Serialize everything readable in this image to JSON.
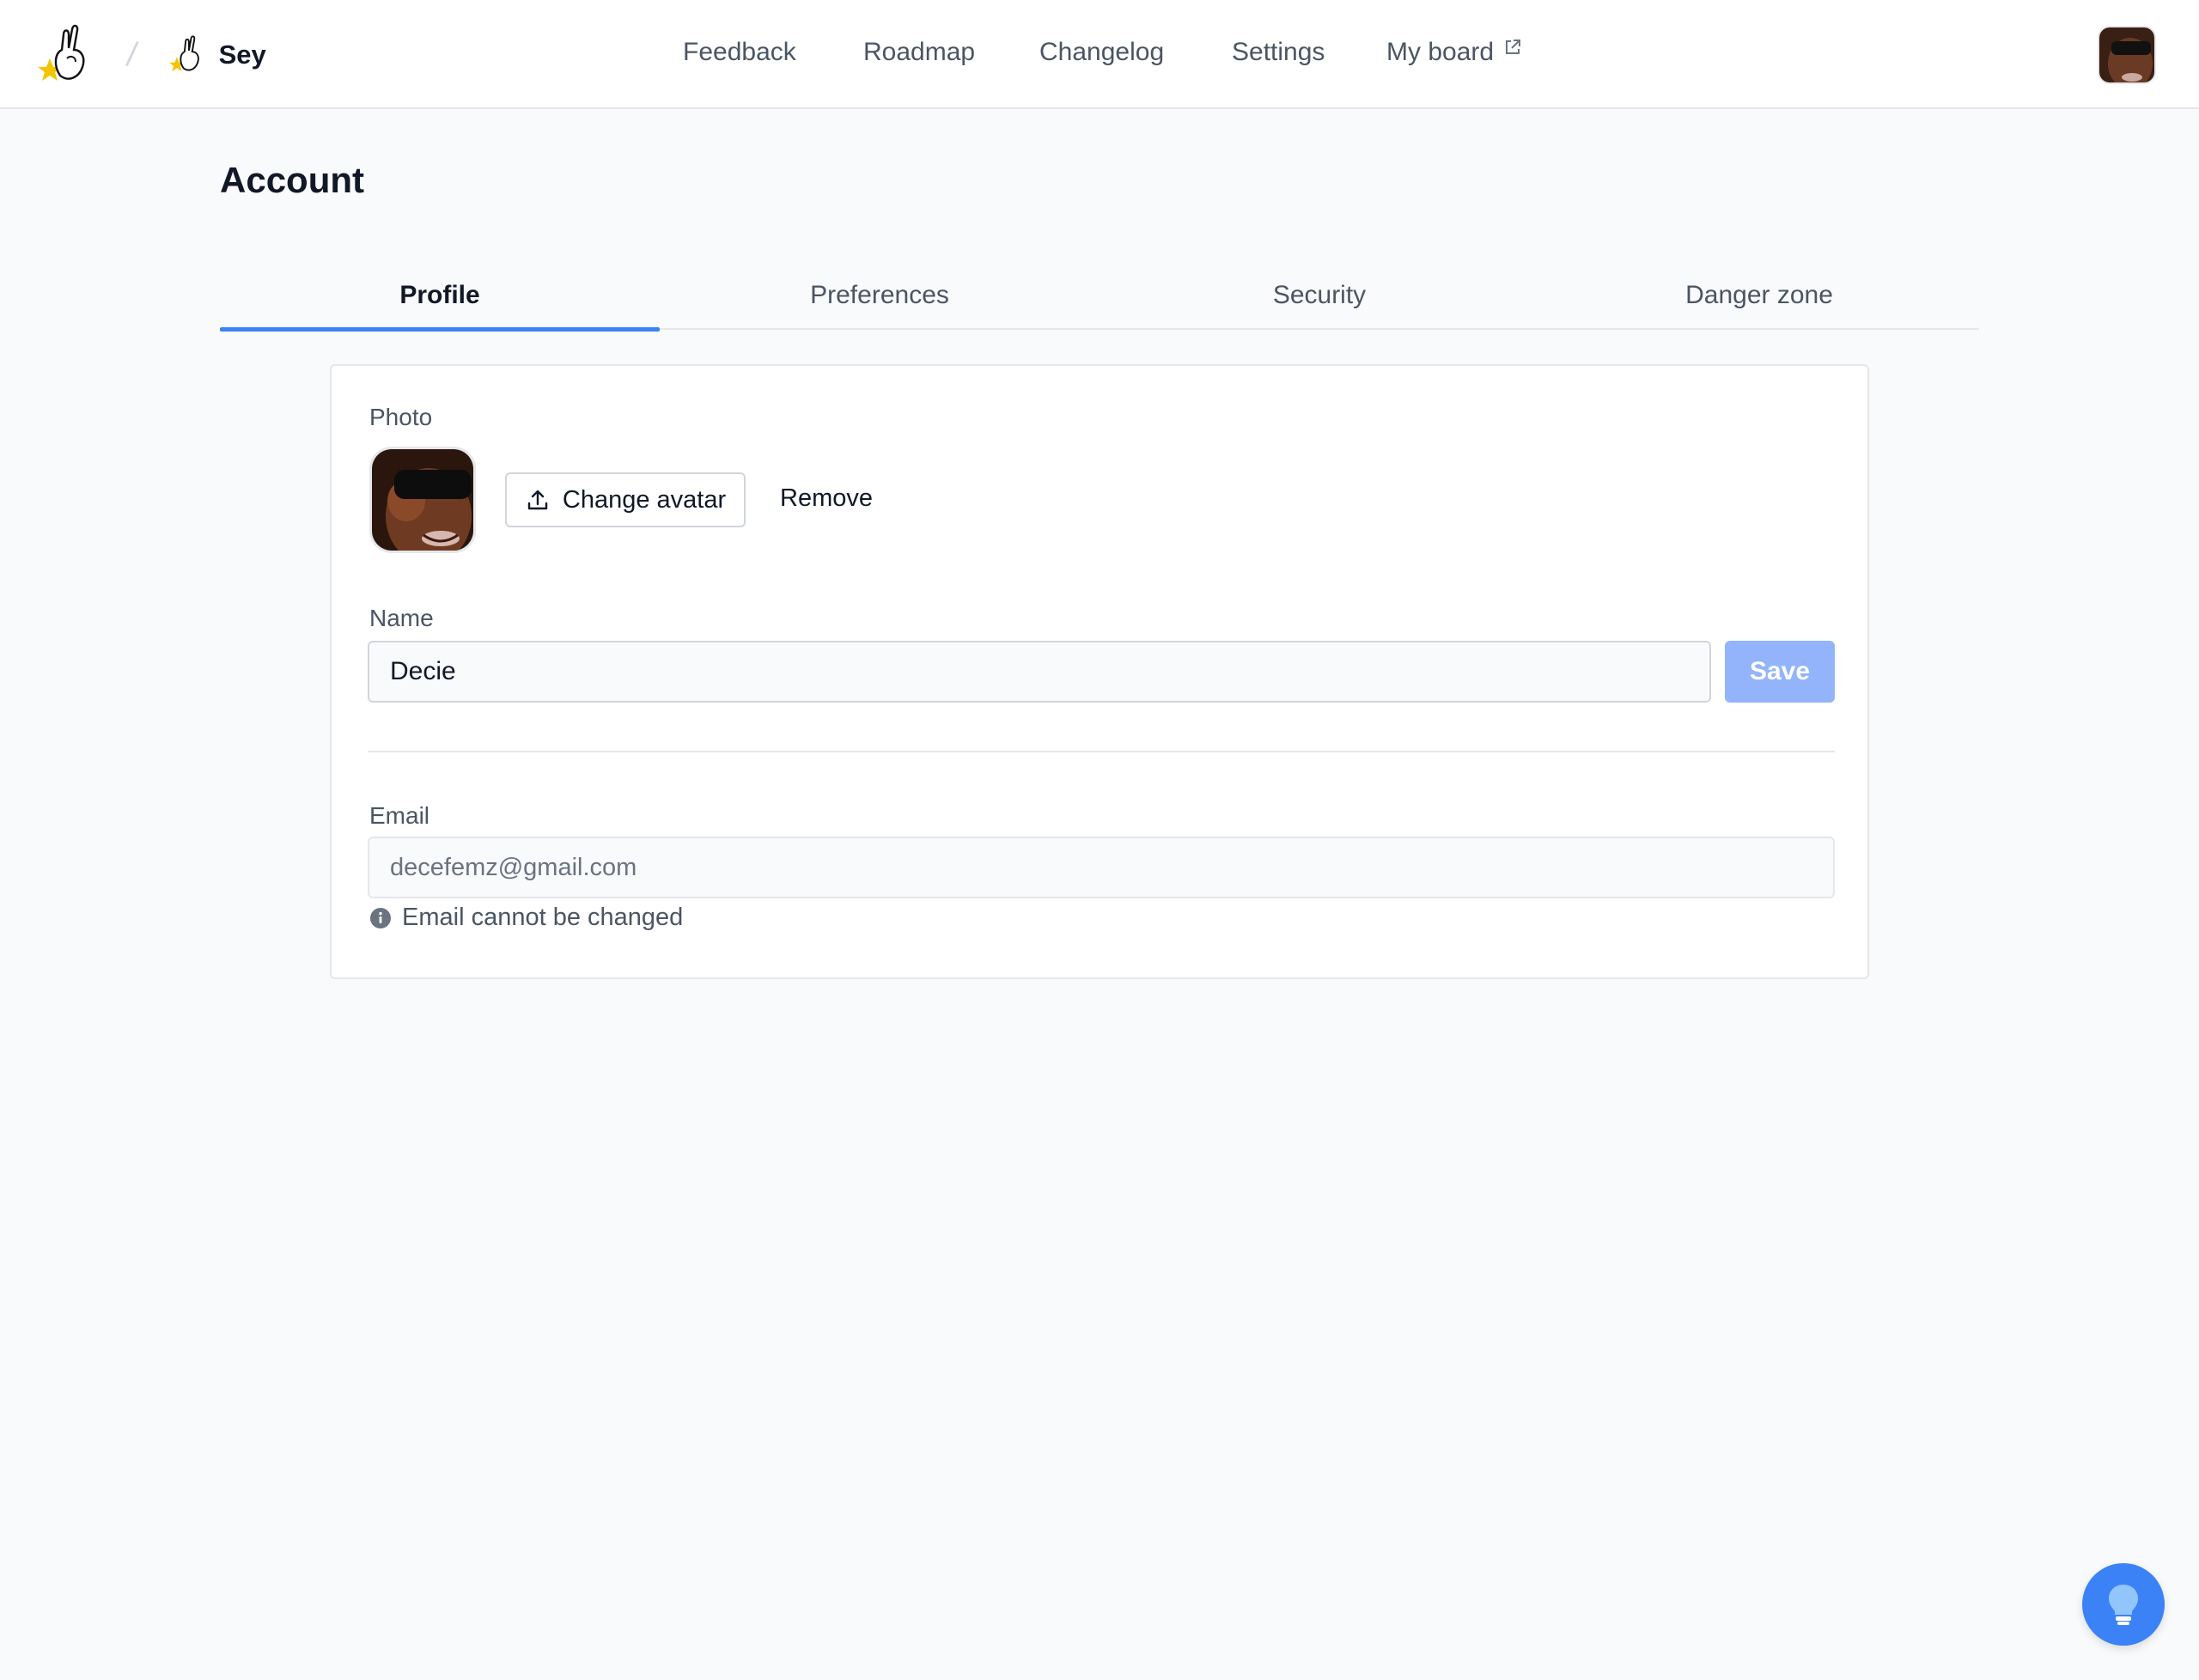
{
  "brand": {
    "name": "Sey",
    "logo_icon": "crossed-fingers-star-icon",
    "separator": "/"
  },
  "nav": {
    "items": [
      {
        "label": "Feedback"
      },
      {
        "label": "Roadmap"
      },
      {
        "label": "Changelog"
      },
      {
        "label": "Settings"
      },
      {
        "label": "My board",
        "icon": "external-link-icon"
      }
    ]
  },
  "page": {
    "title": "Account"
  },
  "tabs": [
    {
      "label": "Profile",
      "active": true
    },
    {
      "label": "Preferences",
      "active": false
    },
    {
      "label": "Security",
      "active": false
    },
    {
      "label": "Danger zone",
      "active": false
    }
  ],
  "profile": {
    "photo_label": "Photo",
    "change_avatar_label": "Change avatar",
    "remove_label": "Remove",
    "name_label": "Name",
    "name_value": "Decie",
    "save_label": "Save",
    "email_label": "Email",
    "email_value": "decefemz@gmail.com",
    "email_hint": "Email cannot be changed"
  },
  "colors": {
    "accent": "#3b82f6",
    "save_disabled": "#93b4fb",
    "background": "#f9fafb"
  },
  "fab": {
    "icon": "lightbulb-icon"
  }
}
